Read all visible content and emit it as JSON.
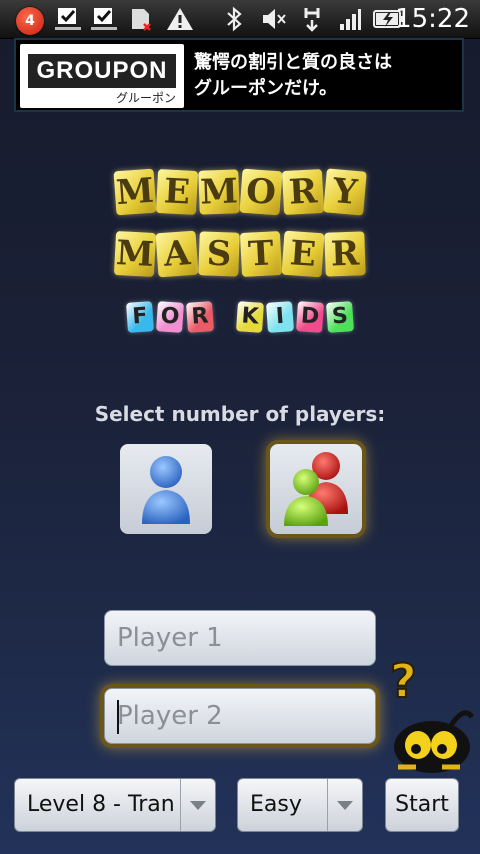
{
  "status_bar": {
    "notification_count": "4",
    "time": "15:22",
    "icons": [
      "task-check-icon",
      "task-check-icon",
      "sd-card-error-icon",
      "warning-icon",
      "bluetooth-icon",
      "mute-icon",
      "data-transfer-icon",
      "signal-icon",
      "battery-charging-icon"
    ]
  },
  "ad": {
    "logo_text": "GROUPON",
    "logo_subtext": "グルーポン",
    "line1": "驚愕の割引と質の良さは",
    "line2": "グルーポンだけ。"
  },
  "title": {
    "line1": [
      "M",
      "E",
      "M",
      "O",
      "R",
      "Y"
    ],
    "line2": [
      "M",
      "A",
      "S",
      "T",
      "E",
      "R"
    ],
    "line3": [
      "F",
      "O",
      "R"
    ],
    "line4": [
      "K",
      "I",
      "D",
      "S"
    ],
    "line3_colors": [
      "#39b8ec",
      "#f08fd2",
      "#ea5a67"
    ],
    "line4_colors": [
      "#e6da3a",
      "#7fe2f0",
      "#f24a8c",
      "#4ee05a"
    ]
  },
  "players": {
    "prompt": "Select number of players:",
    "selected": 2
  },
  "inputs": {
    "player1_placeholder": "Player 1",
    "player2_placeholder": "Player 2"
  },
  "controls": {
    "level_value": "Level 8 - Tran",
    "difficulty_value": "Easy",
    "start_label": "Start"
  },
  "colors": {
    "tile_yellow": "#e8cf3a",
    "selection_glow": "#ffc83c",
    "player_blue": "#3b7fd8",
    "player_green": "#7ecb22",
    "player_red": "#d4241c"
  }
}
